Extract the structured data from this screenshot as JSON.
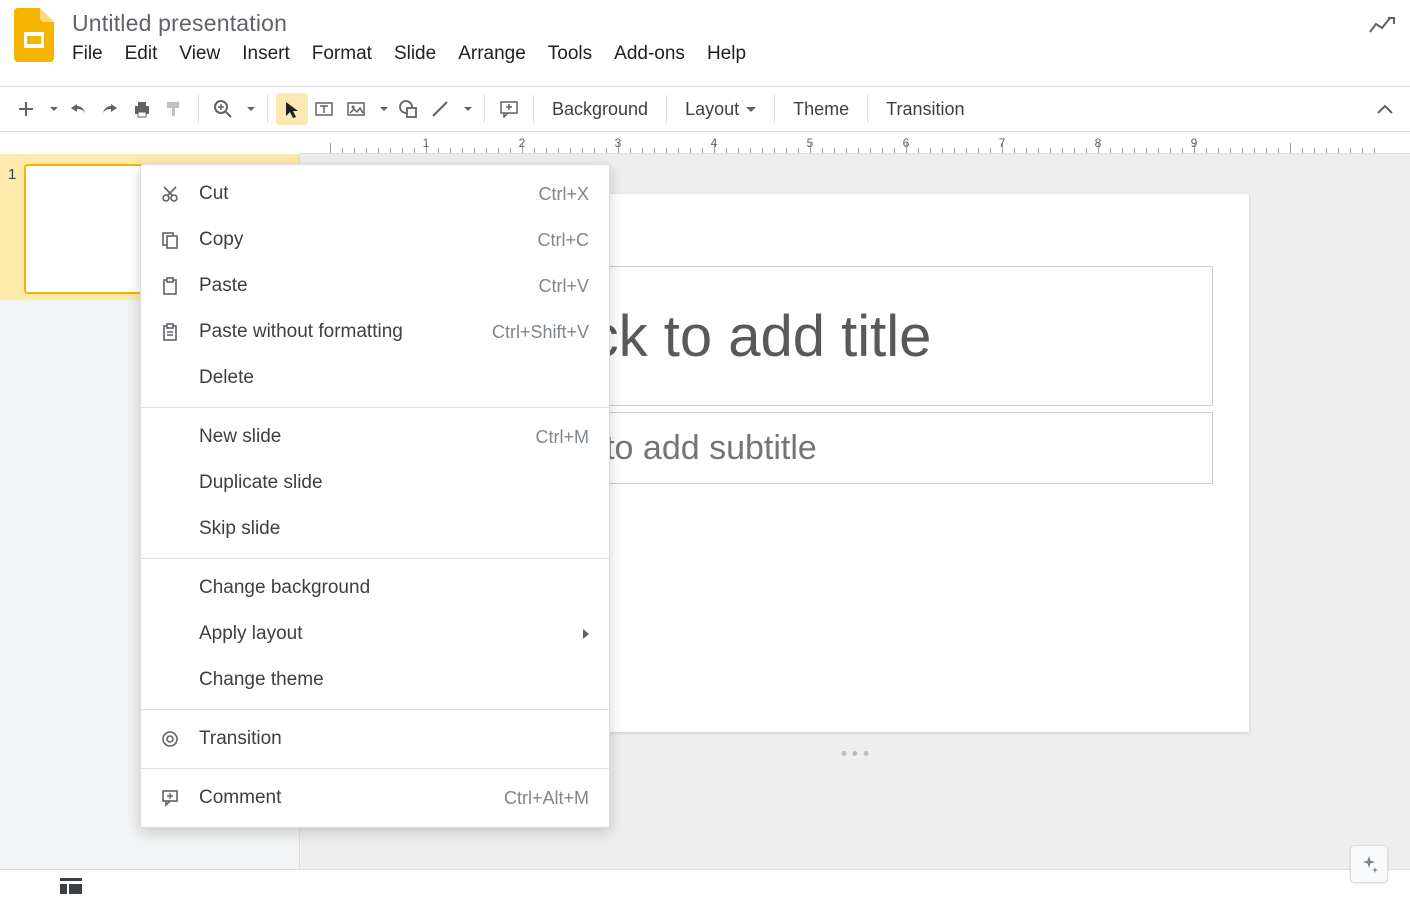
{
  "doc_title": "Untitled presentation",
  "menubar": [
    "File",
    "Edit",
    "View",
    "Insert",
    "Format",
    "Slide",
    "Arrange",
    "Tools",
    "Add-ons",
    "Help"
  ],
  "toolbar": {
    "background": "Background",
    "layout": "Layout",
    "theme": "Theme",
    "transition": "Transition"
  },
  "ruler_numbers": [
    "1",
    "2",
    "3",
    "4",
    "5",
    "6",
    "7",
    "8",
    "9"
  ],
  "thumb_number": "1",
  "slide": {
    "title_placeholder": "Click to add title",
    "subtitle_placeholder": "Click to add subtitle"
  },
  "context_menu": {
    "groups": [
      [
        {
          "icon": "cut",
          "label": "Cut",
          "shortcut": "Ctrl+X"
        },
        {
          "icon": "copy",
          "label": "Copy",
          "shortcut": "Ctrl+C"
        },
        {
          "icon": "paste",
          "label": "Paste",
          "shortcut": "Ctrl+V"
        },
        {
          "icon": "paste-plain",
          "label": "Paste without formatting",
          "shortcut": "Ctrl+Shift+V"
        },
        {
          "icon": "",
          "label": "Delete",
          "shortcut": ""
        }
      ],
      [
        {
          "icon": "",
          "label": "New slide",
          "shortcut": "Ctrl+M"
        },
        {
          "icon": "",
          "label": "Duplicate slide",
          "shortcut": ""
        },
        {
          "icon": "",
          "label": "Skip slide",
          "shortcut": ""
        }
      ],
      [
        {
          "icon": "",
          "label": "Change background",
          "shortcut": ""
        },
        {
          "icon": "",
          "label": "Apply layout",
          "shortcut": "",
          "submenu": true
        },
        {
          "icon": "",
          "label": "Change theme",
          "shortcut": ""
        }
      ],
      [
        {
          "icon": "transition",
          "label": "Transition",
          "shortcut": ""
        }
      ],
      [
        {
          "icon": "comment",
          "label": "Comment",
          "shortcut": "Ctrl+Alt+M"
        }
      ]
    ]
  }
}
